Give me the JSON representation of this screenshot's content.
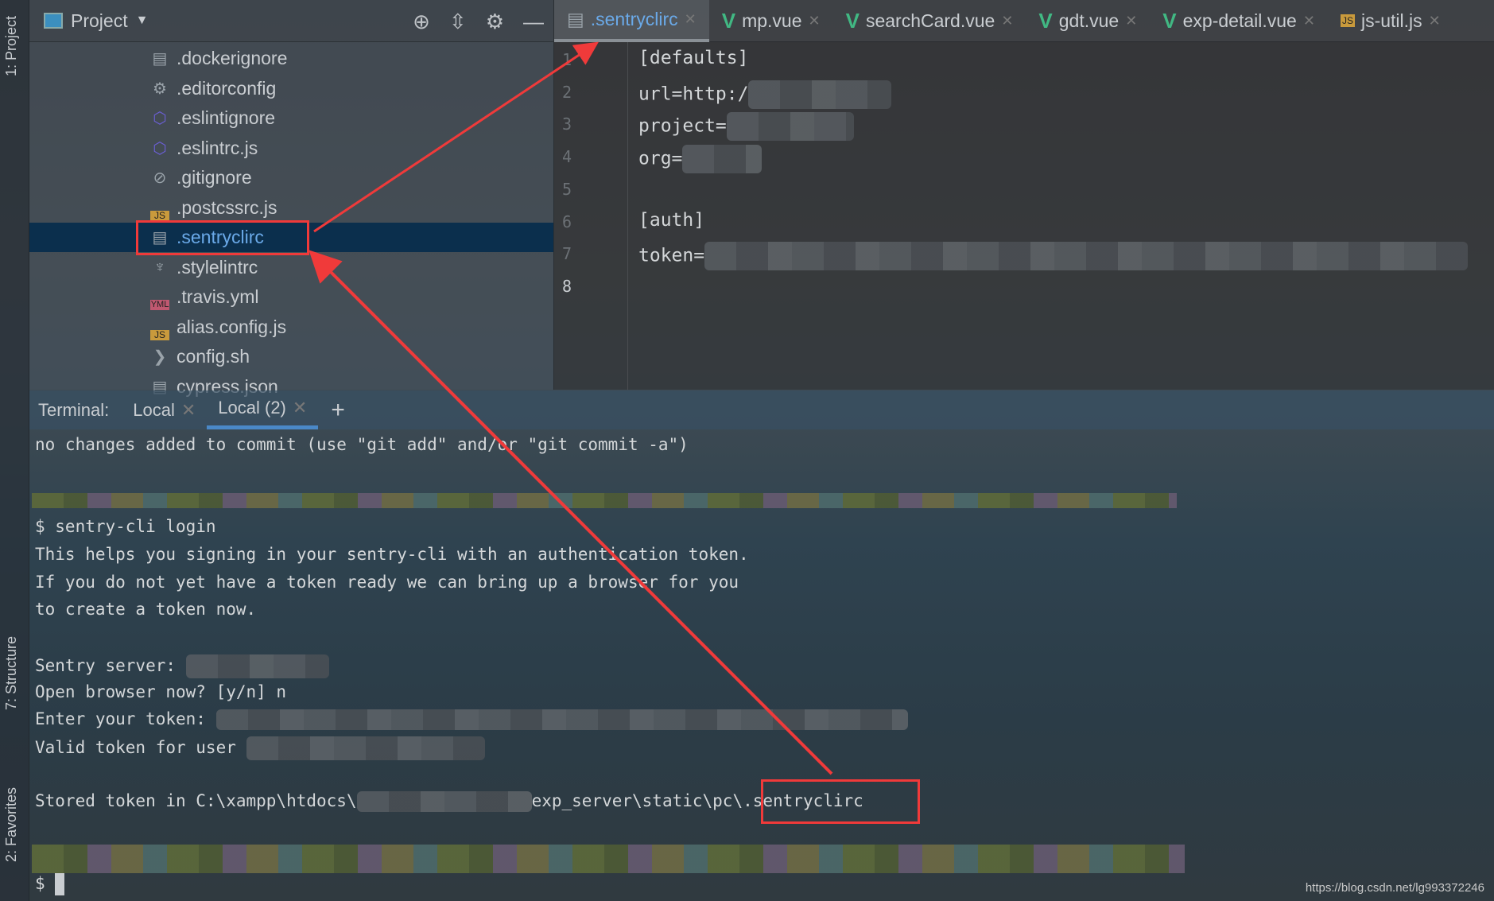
{
  "sidebar": {
    "project_tab": "1: Project",
    "structure_tab": "7: Structure",
    "favorites_tab": "2: Favorites"
  },
  "project": {
    "title": "Project",
    "files": [
      {
        "name": ".dockerignore",
        "icon": "text-file-icon"
      },
      {
        "name": ".editorconfig",
        "icon": "gear-icon"
      },
      {
        "name": ".eslintignore",
        "icon": "eslint-icon"
      },
      {
        "name": ".eslintrc.js",
        "icon": "eslint-icon"
      },
      {
        "name": ".gitignore",
        "icon": "ignore-file-icon"
      },
      {
        "name": ".postcssrc.js",
        "icon": "js-file-icon"
      },
      {
        "name": ".sentryclirc",
        "icon": "text-file-icon",
        "selected": true
      },
      {
        "name": ".stylelintrc",
        "icon": "stylelint-icon"
      },
      {
        "name": ".travis.yml",
        "icon": "yml-file-icon"
      },
      {
        "name": "alias.config.js",
        "icon": "js-file-icon"
      },
      {
        "name": "config.sh",
        "icon": "shell-file-icon"
      },
      {
        "name": "cypress.json",
        "icon": "json-file-icon"
      }
    ]
  },
  "editor": {
    "tabs": [
      {
        "label": ".sentryclirc",
        "icon": "text-file-icon",
        "active": true
      },
      {
        "label": "mp.vue",
        "icon": "vue-icon"
      },
      {
        "label": "searchCard.vue",
        "icon": "vue-icon"
      },
      {
        "label": "gdt.vue",
        "icon": "vue-icon"
      },
      {
        "label": "exp-detail.vue",
        "icon": "vue-icon"
      },
      {
        "label": "js-util.js",
        "icon": "js-file-icon"
      }
    ],
    "lines": [
      "[defaults]",
      "url=http:/",
      "project=",
      "org=",
      "",
      "[auth]",
      "token=",
      ""
    ],
    "line_numbers": [
      "1",
      "2",
      "3",
      "4",
      "5",
      "6",
      "7",
      "8"
    ]
  },
  "terminal": {
    "label": "Terminal:",
    "tabs": [
      "Local",
      "Local (2)"
    ],
    "active_tab": "Local (2)",
    "lines": [
      "no changes added to commit (use \"git add\" and/or \"git commit -a\")",
      "$ sentry-cli login",
      "This helps you signing in your sentry-cli with an authentication token.",
      "If you do not yet have a token ready we can bring up a browser for you",
      "to create a token now.",
      "Sentry server:",
      "Open browser now? [y/n] n",
      "Enter your token:",
      "Valid token for user",
      "Stored token in C:\\xampp\\htdocs\\",
      "exp_server\\static\\pc\\.sentryclirc",
      "$"
    ]
  },
  "watermark": "https://blog.csdn.net/lg993372246",
  "colors": {
    "annotation": "#f03a3a",
    "selection": "#0b2f4d",
    "vue": "#41b883",
    "link": "#6aa9e8"
  }
}
